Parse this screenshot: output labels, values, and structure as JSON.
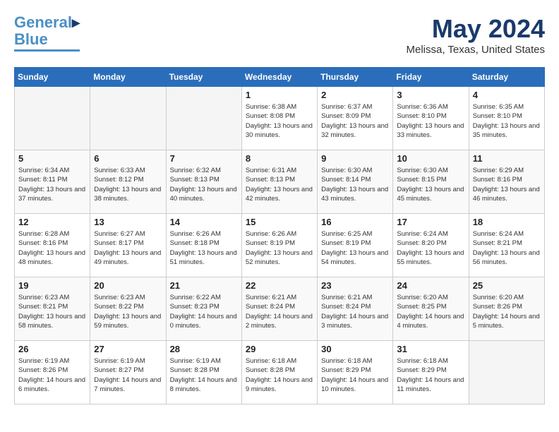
{
  "header": {
    "logo_line1": "General",
    "logo_line2": "Blue",
    "month": "May 2024",
    "location": "Melissa, Texas, United States"
  },
  "weekdays": [
    "Sunday",
    "Monday",
    "Tuesday",
    "Wednesday",
    "Thursday",
    "Friday",
    "Saturday"
  ],
  "weeks": [
    [
      {
        "day": "",
        "empty": true
      },
      {
        "day": "",
        "empty": true
      },
      {
        "day": "",
        "empty": true
      },
      {
        "day": "1",
        "sunrise": "6:38 AM",
        "sunset": "8:08 PM",
        "daylight": "13 hours and 30 minutes."
      },
      {
        "day": "2",
        "sunrise": "6:37 AM",
        "sunset": "8:09 PM",
        "daylight": "13 hours and 32 minutes."
      },
      {
        "day": "3",
        "sunrise": "6:36 AM",
        "sunset": "8:10 PM",
        "daylight": "13 hours and 33 minutes."
      },
      {
        "day": "4",
        "sunrise": "6:35 AM",
        "sunset": "8:10 PM",
        "daylight": "13 hours and 35 minutes."
      }
    ],
    [
      {
        "day": "5",
        "sunrise": "6:34 AM",
        "sunset": "8:11 PM",
        "daylight": "13 hours and 37 minutes."
      },
      {
        "day": "6",
        "sunrise": "6:33 AM",
        "sunset": "8:12 PM",
        "daylight": "13 hours and 38 minutes."
      },
      {
        "day": "7",
        "sunrise": "6:32 AM",
        "sunset": "8:13 PM",
        "daylight": "13 hours and 40 minutes."
      },
      {
        "day": "8",
        "sunrise": "6:31 AM",
        "sunset": "8:13 PM",
        "daylight": "13 hours and 42 minutes."
      },
      {
        "day": "9",
        "sunrise": "6:30 AM",
        "sunset": "8:14 PM",
        "daylight": "13 hours and 43 minutes."
      },
      {
        "day": "10",
        "sunrise": "6:30 AM",
        "sunset": "8:15 PM",
        "daylight": "13 hours and 45 minutes."
      },
      {
        "day": "11",
        "sunrise": "6:29 AM",
        "sunset": "8:16 PM",
        "daylight": "13 hours and 46 minutes."
      }
    ],
    [
      {
        "day": "12",
        "sunrise": "6:28 AM",
        "sunset": "8:16 PM",
        "daylight": "13 hours and 48 minutes."
      },
      {
        "day": "13",
        "sunrise": "6:27 AM",
        "sunset": "8:17 PM",
        "daylight": "13 hours and 49 minutes."
      },
      {
        "day": "14",
        "sunrise": "6:26 AM",
        "sunset": "8:18 PM",
        "daylight": "13 hours and 51 minutes."
      },
      {
        "day": "15",
        "sunrise": "6:26 AM",
        "sunset": "8:19 PM",
        "daylight": "13 hours and 52 minutes."
      },
      {
        "day": "16",
        "sunrise": "6:25 AM",
        "sunset": "8:19 PM",
        "daylight": "13 hours and 54 minutes."
      },
      {
        "day": "17",
        "sunrise": "6:24 AM",
        "sunset": "8:20 PM",
        "daylight": "13 hours and 55 minutes."
      },
      {
        "day": "18",
        "sunrise": "6:24 AM",
        "sunset": "8:21 PM",
        "daylight": "13 hours and 56 minutes."
      }
    ],
    [
      {
        "day": "19",
        "sunrise": "6:23 AM",
        "sunset": "8:21 PM",
        "daylight": "13 hours and 58 minutes."
      },
      {
        "day": "20",
        "sunrise": "6:23 AM",
        "sunset": "8:22 PM",
        "daylight": "13 hours and 59 minutes."
      },
      {
        "day": "21",
        "sunrise": "6:22 AM",
        "sunset": "8:23 PM",
        "daylight": "14 hours and 0 minutes."
      },
      {
        "day": "22",
        "sunrise": "6:21 AM",
        "sunset": "8:24 PM",
        "daylight": "14 hours and 2 minutes."
      },
      {
        "day": "23",
        "sunrise": "6:21 AM",
        "sunset": "8:24 PM",
        "daylight": "14 hours and 3 minutes."
      },
      {
        "day": "24",
        "sunrise": "6:20 AM",
        "sunset": "8:25 PM",
        "daylight": "14 hours and 4 minutes."
      },
      {
        "day": "25",
        "sunrise": "6:20 AM",
        "sunset": "8:26 PM",
        "daylight": "14 hours and 5 minutes."
      }
    ],
    [
      {
        "day": "26",
        "sunrise": "6:19 AM",
        "sunset": "8:26 PM",
        "daylight": "14 hours and 6 minutes."
      },
      {
        "day": "27",
        "sunrise": "6:19 AM",
        "sunset": "8:27 PM",
        "daylight": "14 hours and 7 minutes."
      },
      {
        "day": "28",
        "sunrise": "6:19 AM",
        "sunset": "8:28 PM",
        "daylight": "14 hours and 8 minutes."
      },
      {
        "day": "29",
        "sunrise": "6:18 AM",
        "sunset": "8:28 PM",
        "daylight": "14 hours and 9 minutes."
      },
      {
        "day": "30",
        "sunrise": "6:18 AM",
        "sunset": "8:29 PM",
        "daylight": "14 hours and 10 minutes."
      },
      {
        "day": "31",
        "sunrise": "6:18 AM",
        "sunset": "8:29 PM",
        "daylight": "14 hours and 11 minutes."
      },
      {
        "day": "",
        "empty": true
      }
    ]
  ]
}
